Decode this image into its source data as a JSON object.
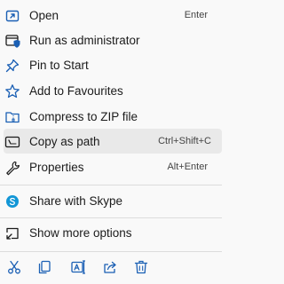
{
  "menu": {
    "items": [
      {
        "label": "Open",
        "shortcut": "Enter",
        "icon": "open-icon"
      },
      {
        "label": "Run as administrator",
        "shortcut": "",
        "icon": "shield-window-icon"
      },
      {
        "label": "Pin to Start",
        "shortcut": "",
        "icon": "pin-icon"
      },
      {
        "label": "Add to Favourites",
        "shortcut": "",
        "icon": "star-icon"
      },
      {
        "label": "Compress to ZIP file",
        "shortcut": "",
        "icon": "zip-folder-icon"
      },
      {
        "label": "Copy as path",
        "shortcut": "Ctrl+Shift+C",
        "icon": "copy-path-icon"
      },
      {
        "label": "Properties",
        "shortcut": "Alt+Enter",
        "icon": "wrench-icon"
      },
      {
        "label": "Share with Skype",
        "shortcut": "",
        "icon": "skype-icon"
      },
      {
        "label": "Show more options",
        "shortcut": "",
        "icon": "show-more-options-icon"
      }
    ],
    "bottom_actions": [
      "cut-icon",
      "copy-icon",
      "rename-icon",
      "share-icon",
      "delete-icon"
    ],
    "colors": {
      "accent": "#1a5fb4",
      "skype": "#1296d6",
      "hover_bg": "#e9e9e9",
      "text": "#1b1b1b",
      "separator": "#dcdcdc"
    }
  }
}
